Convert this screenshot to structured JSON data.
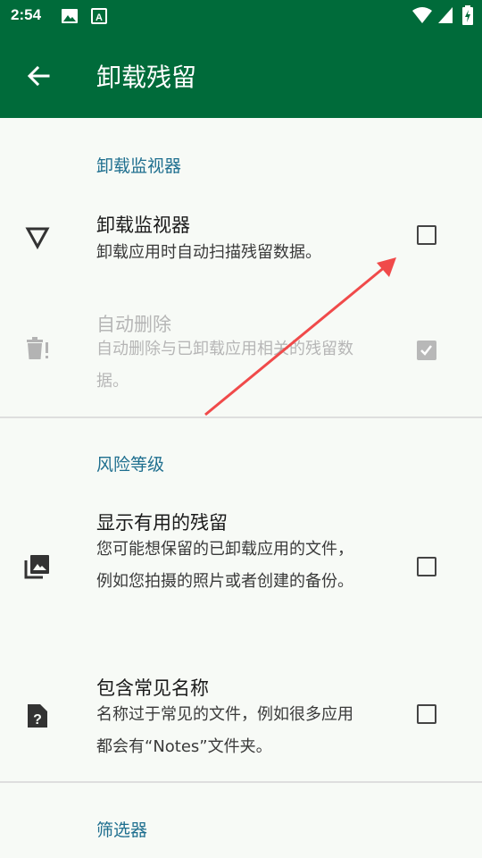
{
  "status_bar": {
    "time": "2:54",
    "icons": [
      "image-icon",
      "text-a-icon",
      "wifi-icon",
      "signal-icon",
      "battery-charging-icon"
    ]
  },
  "app_bar": {
    "back_icon": "arrow-left-icon",
    "title": "卸载残留"
  },
  "sections": [
    {
      "header": "卸载监视器",
      "items": [
        {
          "title": "卸载监视器",
          "subtitle": "卸载应用时自动扫描残留数据。",
          "icon": "triangle-outline-icon",
          "checked": false,
          "enabled": true
        },
        {
          "title": "自动删除",
          "subtitle": "自动删除与已卸载应用相关的残留数据。",
          "icon": "trash-alert-icon",
          "checked": true,
          "enabled": false
        }
      ]
    },
    {
      "header": "风险等级",
      "items": [
        {
          "title": "显示有用的残留",
          "subtitle": "您可能想保留的已卸载应用的文件，例如您拍摄的照片或者创建的备份。",
          "icon": "image-stack-icon",
          "checked": false,
          "enabled": true
        },
        {
          "title": "包含常见名称",
          "subtitle": "名称过于常见的文件，例如很多应用都会有“Notes”文件夹。",
          "icon": "file-question-icon",
          "checked": false,
          "enabled": true
        }
      ]
    },
    {
      "header": "筛选器",
      "items": []
    }
  ],
  "colors": {
    "primary": "#006b3a",
    "accent": "#1f6f8f",
    "annotation_arrow": "#f04a4a",
    "background": "#f7faf6"
  }
}
